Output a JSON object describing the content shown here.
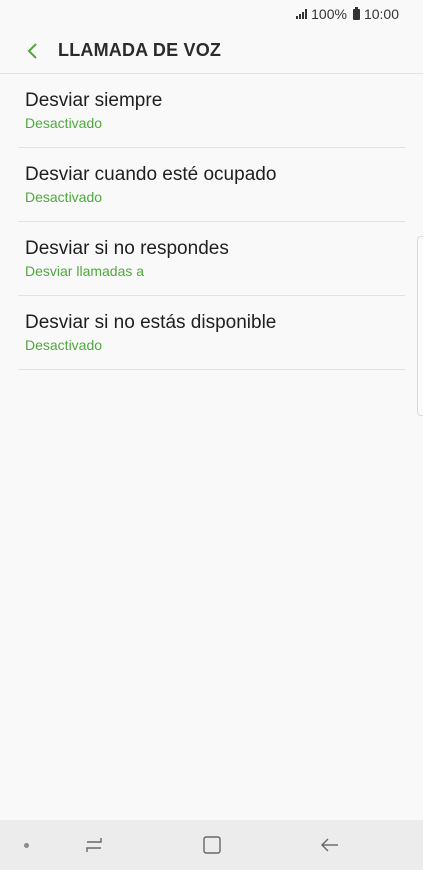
{
  "status_bar": {
    "battery": "100%",
    "time": "10:00"
  },
  "header": {
    "title": "LLAMADA DE VOZ"
  },
  "items": [
    {
      "title": "Desviar siempre",
      "subtitle": "Desactivado"
    },
    {
      "title": "Desviar cuando esté ocupado",
      "subtitle": "Desactivado"
    },
    {
      "title": "Desviar si no respondes",
      "subtitle": "Desviar llamadas a"
    },
    {
      "title": "Desviar si no estás disponible",
      "subtitle": "Desactivado"
    }
  ],
  "colors": {
    "accent": "#4fa83d",
    "background": "#f9f9f9",
    "nav_bar": "#ececec"
  }
}
